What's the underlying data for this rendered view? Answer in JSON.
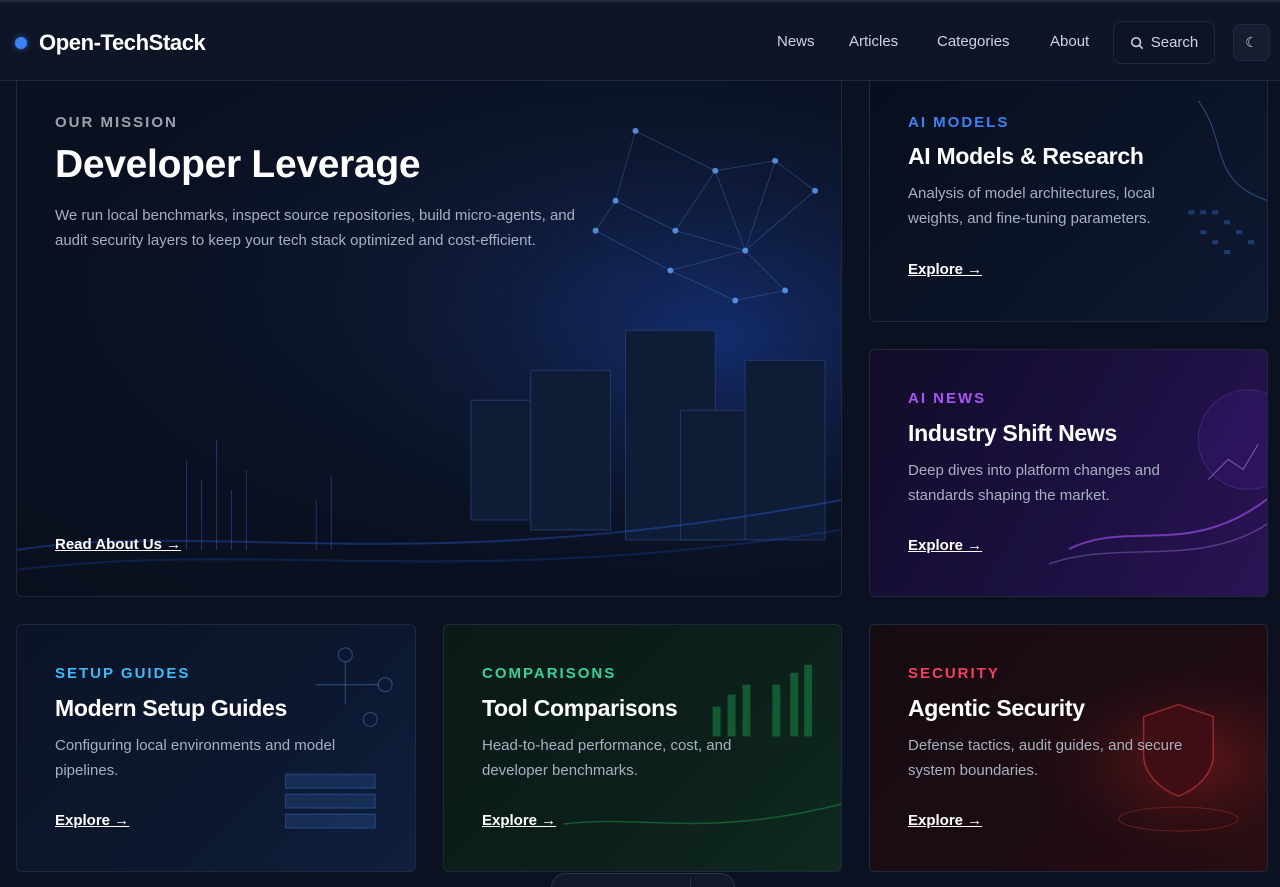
{
  "header": {
    "brand": "Open-TechStack",
    "nav": [
      "News",
      "Articles",
      "Categories",
      "About"
    ],
    "search_label": "Search",
    "theme_icon": "moon-icon"
  },
  "colors": {
    "accent": "#3b82f6",
    "ai_models": "#3b82f6",
    "ai_news": "#a855f7",
    "setup": "#38bdf8",
    "comparisons": "#34d399",
    "security": "#f43f5e"
  },
  "hero": {
    "eyebrow": "OUR MISSION",
    "title": "Developer Leverage",
    "description": "We run local benchmarks, inspect source repositories, build micro-agents, and audit security layers to keep your tech stack optimized and cost-efficient.",
    "link": "Read About Us →"
  },
  "cards": {
    "ai_models": {
      "eyebrow": "AI MODELS",
      "title": "AI Models & Research",
      "description": "Analysis of model architectures, local weights, and fine-tuning parameters.",
      "link": "Explore →"
    },
    "ai_news": {
      "eyebrow": "AI NEWS",
      "title": "Industry Shift News",
      "description": "Deep dives into platform changes and standards shaping the market.",
      "link": "Explore →"
    },
    "setup": {
      "eyebrow": "SETUP GUIDES",
      "title": "Modern Setup Guides",
      "description": "Configuring local environments and model pipelines.",
      "link": "Explore →"
    },
    "comparisons": {
      "eyebrow": "COMPARISONS",
      "title": "Tool Comparisons",
      "description": "Head-to-head performance, cost, and developer benchmarks.",
      "link": "Explore →"
    },
    "security": {
      "eyebrow": "SECURITY",
      "title": "Agentic Security",
      "description": "Defense tactics, audit guides, and secure system boundaries.",
      "link": "Explore →"
    }
  }
}
